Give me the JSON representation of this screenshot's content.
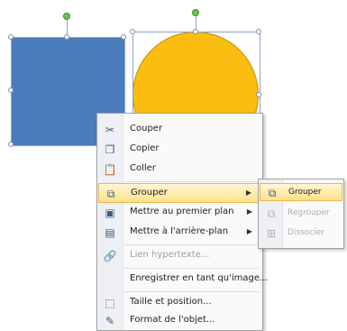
{
  "colors": {
    "square_fill": "#4a7bbd",
    "circle_fill": "#fbbd10",
    "rotation_handle": "#6cc24a",
    "menu_highlight": "#ffe189"
  },
  "context_menu": {
    "items": [
      {
        "label": "Couper",
        "icon": "scissors-icon",
        "enabled": true
      },
      {
        "label": "Copier",
        "icon": "copy-icon",
        "enabled": true
      },
      {
        "label": "Coller",
        "icon": "paste-icon",
        "enabled": true
      },
      {
        "label": "Grouper",
        "icon": "group-icon",
        "enabled": true,
        "submenu": true,
        "highlighted": true
      },
      {
        "label": "Mettre au premier plan",
        "icon": "bring-front-icon",
        "enabled": true,
        "submenu": true
      },
      {
        "label": "Mettre à l'arrière-plan",
        "icon": "send-back-icon",
        "enabled": true,
        "submenu": true
      },
      {
        "label": "Lien hypertexte...",
        "icon": "hyperlink-icon",
        "enabled": false
      },
      {
        "label": "Enregistrer en tant qu'image...",
        "icon": "",
        "enabled": true
      },
      {
        "label": "Taille et position...",
        "icon": "size-position-icon",
        "enabled": true
      },
      {
        "label": "Format de l'objet...",
        "icon": "format-object-icon",
        "enabled": true
      }
    ]
  },
  "submenu": {
    "items": [
      {
        "label": "Grouper",
        "icon": "group-icon",
        "enabled": true,
        "highlighted": true
      },
      {
        "label": "Regrouper",
        "icon": "regroup-icon",
        "enabled": false
      },
      {
        "label": "Dissocier",
        "icon": "ungroup-icon",
        "enabled": false
      }
    ]
  }
}
